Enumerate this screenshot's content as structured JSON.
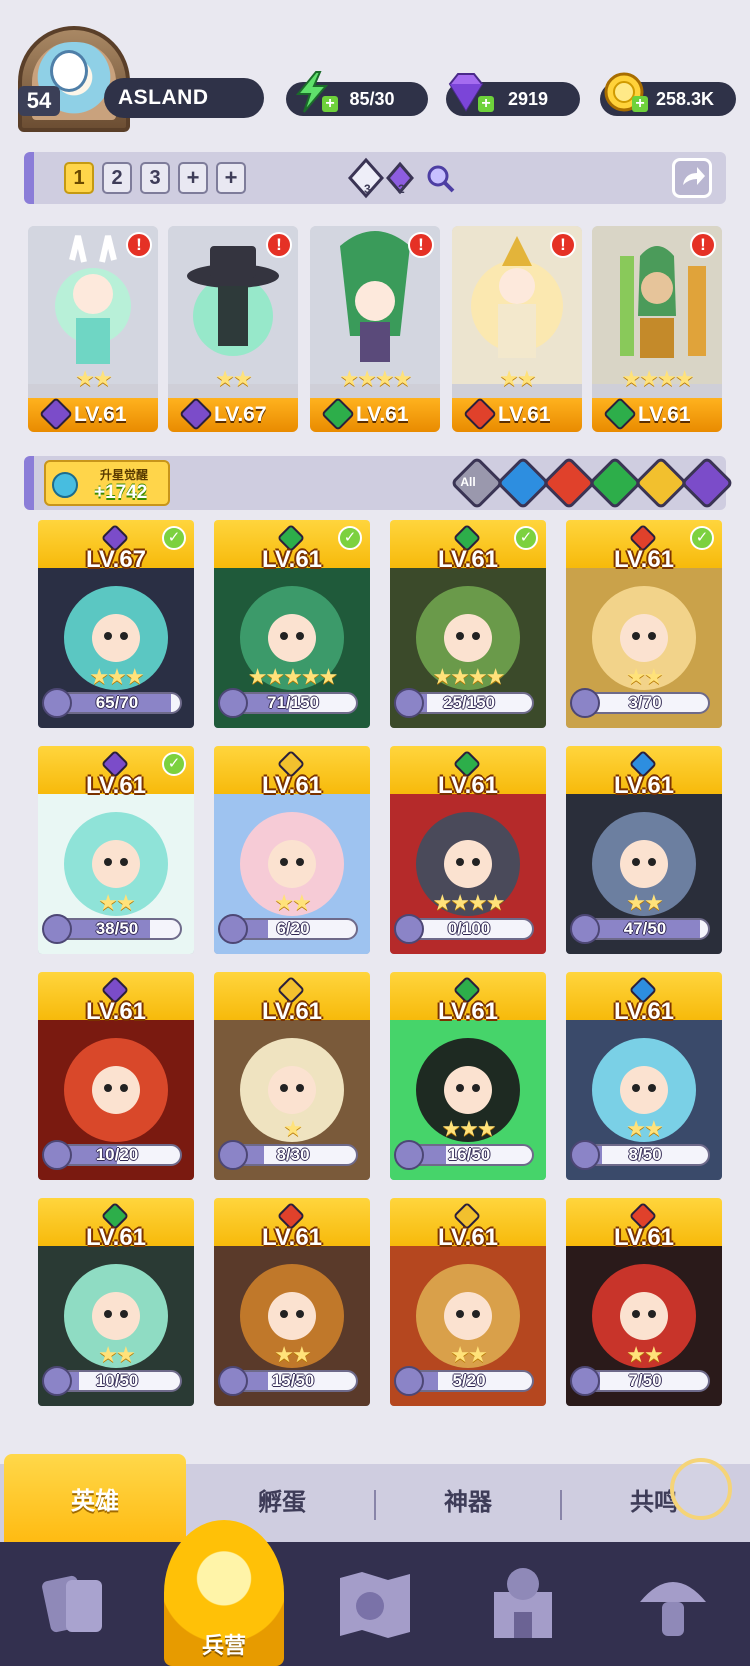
{
  "player": {
    "level": "54",
    "name": "ASLAND"
  },
  "resources": {
    "energy": "85/30",
    "gems": "2919",
    "gold": "258.3K"
  },
  "team_bar": {
    "slots": [
      "1",
      "2",
      "3",
      "+",
      "+"
    ],
    "gem_white_count": "3",
    "gem_purple_count": "2"
  },
  "team": [
    {
      "level": "LV.61",
      "element": "dark",
      "stars": "★★",
      "alert": "!"
    },
    {
      "level": "LV.67",
      "element": "dark",
      "stars": "★★",
      "alert": "!"
    },
    {
      "level": "LV.61",
      "element": "nature",
      "stars": "★★★★",
      "alert": "!"
    },
    {
      "level": "LV.61",
      "element": "fire",
      "stars": "★★",
      "alert": "!"
    },
    {
      "level": "LV.61",
      "element": "nature",
      "stars": "★★★★",
      "alert": "!"
    }
  ],
  "awaken": {
    "label": "升星觉醒",
    "value": "+1742"
  },
  "filter": {
    "all": "All"
  },
  "heroes": [
    {
      "level": "LV.67",
      "element": "dark",
      "progress": "65/70",
      "fraction": 0.93,
      "check": "✓",
      "stars": "★★★"
    },
    {
      "level": "LV.61",
      "element": "nature",
      "progress": "71/150",
      "fraction": 0.47,
      "check": "✓",
      "stars": "★★★★★"
    },
    {
      "level": "LV.61",
      "element": "nature",
      "progress": "25/150",
      "fraction": 0.17,
      "check": "✓",
      "stars": "★★★★"
    },
    {
      "level": "LV.61",
      "element": "fire",
      "progress": "3/70",
      "fraction": 0.04,
      "check": "✓",
      "stars": "★★"
    },
    {
      "level": "LV.61",
      "element": "dark",
      "progress": "38/50",
      "fraction": 0.76,
      "check": "✓",
      "stars": "★★"
    },
    {
      "level": "LV.61",
      "element": "light",
      "progress": "6/20",
      "fraction": 0.3,
      "check": "",
      "stars": "★★"
    },
    {
      "level": "LV.61",
      "element": "nature",
      "progress": "0/100",
      "fraction": 0.0,
      "check": "",
      "stars": "★★★★"
    },
    {
      "level": "LV.61",
      "element": "water",
      "progress": "47/50",
      "fraction": 0.94,
      "check": "",
      "stars": "★★"
    },
    {
      "level": "LV.61",
      "element": "dark",
      "progress": "10/20",
      "fraction": 0.5,
      "check": "",
      "stars": ""
    },
    {
      "level": "LV.61",
      "element": "light",
      "progress": "8/30",
      "fraction": 0.27,
      "check": "",
      "stars": "★"
    },
    {
      "level": "LV.61",
      "element": "nature",
      "progress": "16/50",
      "fraction": 0.32,
      "check": "",
      "stars": "★★★"
    },
    {
      "level": "LV.61",
      "element": "water",
      "progress": "8/50",
      "fraction": 0.16,
      "check": "",
      "stars": "★★"
    },
    {
      "level": "LV.61",
      "element": "nature",
      "progress": "10/50",
      "fraction": 0.2,
      "check": "",
      "stars": "★★"
    },
    {
      "level": "LV.61",
      "element": "fire",
      "progress": "15/50",
      "fraction": 0.3,
      "check": "",
      "stars": "★★"
    },
    {
      "level": "LV.61",
      "element": "light",
      "progress": "5/20",
      "fraction": 0.25,
      "check": "",
      "stars": "★★"
    },
    {
      "level": "LV.61",
      "element": "fire",
      "progress": "7/50",
      "fraction": 0.14,
      "check": "",
      "stars": "★★"
    }
  ],
  "sub_tabs": [
    "英雄",
    "孵蛋",
    "神器",
    "共鸣"
  ],
  "bottom_nav": {
    "active_label": "兵营",
    "items": [
      "cards-icon",
      "barracks-icon",
      "map-icon",
      "castle-icon",
      "mushroom-icon"
    ]
  },
  "colors": {
    "dark": "#7b4cc9",
    "nature": "#2dae4a",
    "fire": "#e0412b",
    "light": "#f2c02e",
    "water": "#2d8ee0"
  }
}
